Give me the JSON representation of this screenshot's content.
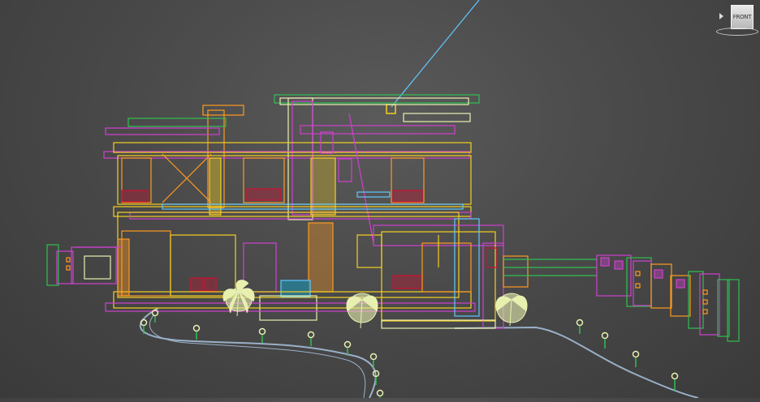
{
  "viewport": {
    "view_label": "FRONT",
    "background": "#4a4a4a"
  },
  "colors": {
    "yellow": "#f5d020",
    "orange": "#ff9a20",
    "magenta": "#d040d0",
    "red": "#d01030",
    "green": "#30c050",
    "cyan": "#60c8ff",
    "pale": "#e8f0b0",
    "path": "#9ab0c8"
  },
  "icons": {
    "viewcube": "viewcube-icon",
    "viewcube_arrow": "triangle-right-icon",
    "tree": "palm-tree-icon",
    "lamp": "garden-lamp-icon",
    "camera_target": "camera-target-icon"
  }
}
